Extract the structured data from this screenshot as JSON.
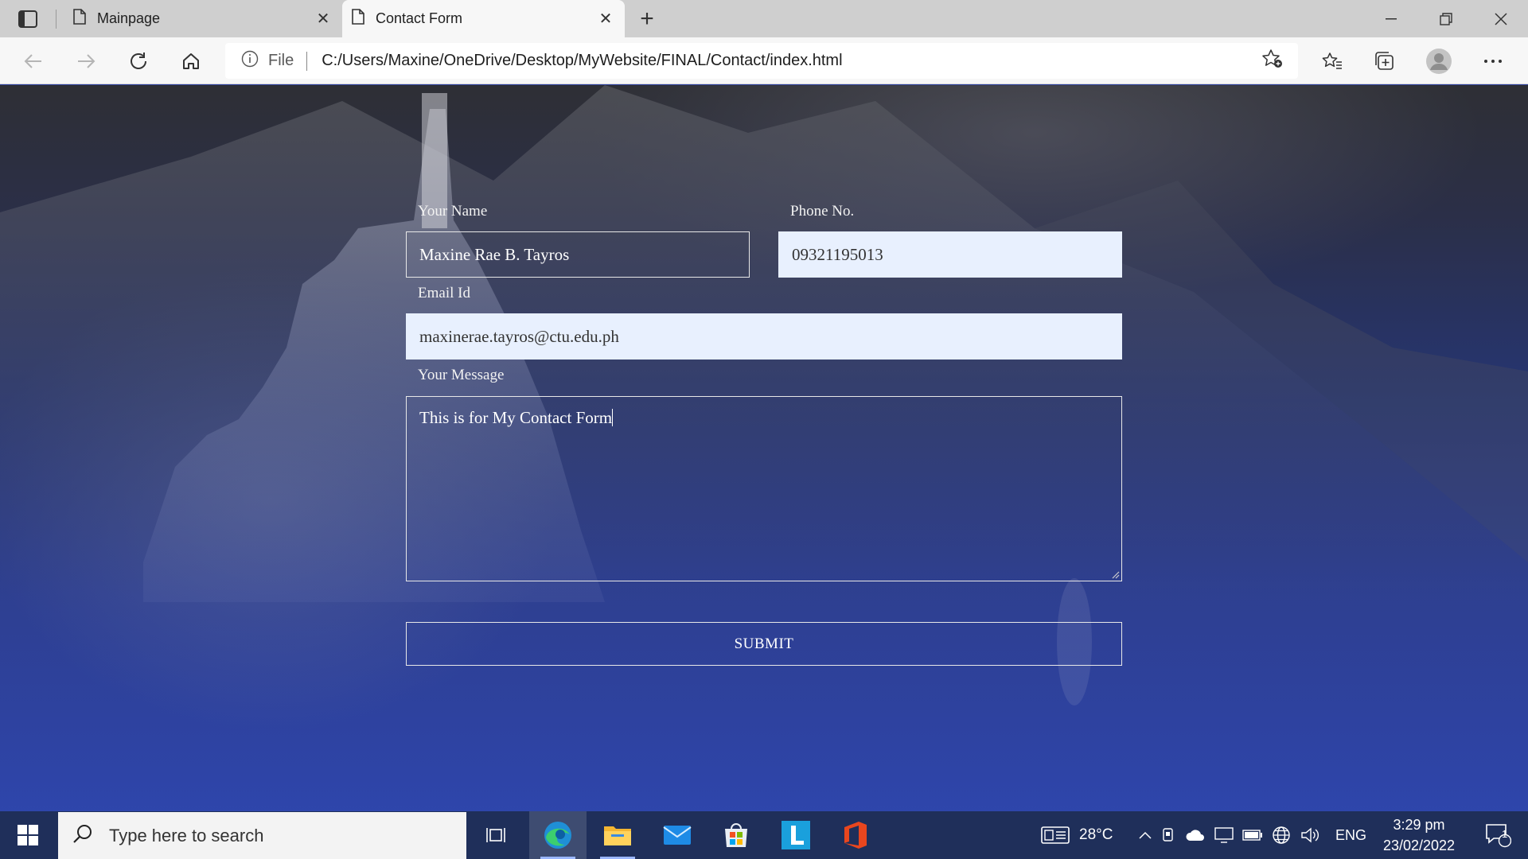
{
  "browser": {
    "tabs": [
      {
        "title": "Mainpage",
        "active": false
      },
      {
        "title": "Contact Form",
        "active": true
      }
    ],
    "new_tab": "+",
    "address_bar": {
      "scheme_label": "File",
      "url": "C:/Users/Maxine/OneDrive/Desktop/MyWebsite/FINAL/Contact/index.html"
    }
  },
  "form": {
    "name_label": "Your Name",
    "name_value": "Maxine Rae B. Tayros",
    "phone_label": "Phone No.",
    "phone_value": "09321195013",
    "email_label": "Email Id",
    "email_value": "maxinerae.tayros@ctu.edu.ph",
    "message_label": "Your Message",
    "message_value": "This is for My Contact Form",
    "submit_label": "SUBMIT"
  },
  "taskbar": {
    "search_placeholder": "Type here to search",
    "weather": "28°C",
    "language": "ENG",
    "time": "3:29 pm",
    "date": "23/02/2022",
    "notification_count": "1",
    "apps": [
      "task-view",
      "edge",
      "file-explorer",
      "mail",
      "microsoft-store",
      "l-app",
      "office"
    ]
  },
  "colors": {
    "accent": "#2f47b0",
    "taskbar": "#1f2f5a",
    "autofill": "#e8f0fe"
  }
}
